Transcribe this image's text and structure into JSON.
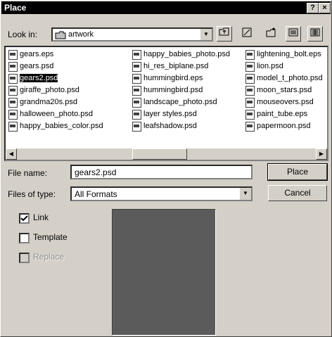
{
  "window": {
    "title": "Place",
    "help_label": "?",
    "close_label": "×"
  },
  "lookin": {
    "label": "Look in:",
    "value": "artwork",
    "icons": [
      "up-folder-icon",
      "desktop-icon",
      "new-folder-icon",
      "list-view-icon",
      "details-view-icon"
    ]
  },
  "files": {
    "col1": [
      "gears.eps",
      "gears.psd",
      "gears2.psd",
      "giraffe_photo.psd",
      "grandma20s.psd",
      "halloween_photo.psd",
      "happy_babies_color.psd"
    ],
    "col2": [
      "happy_babies_photo.psd",
      "hi_res_biplane.psd",
      "hummingbird.eps",
      "hummingbird.psd",
      "landscape_photo.psd",
      "layer styles.psd",
      "leafshadow.psd"
    ],
    "col3": [
      "lightening_bolt.eps",
      "lion.psd",
      "model_t_photo.psd",
      "moon_stars.psd",
      "mouseovers.psd",
      "paint_tube.eps",
      "papermoon.psd"
    ],
    "selected": "gears2.psd"
  },
  "filename": {
    "label": "File name:",
    "value": "gears2.psd"
  },
  "filetype": {
    "label": "Files of type:",
    "value": "All Formats"
  },
  "buttons": {
    "place": "Place",
    "cancel": "Cancel"
  },
  "options": {
    "link": {
      "label": "Link",
      "checked": true
    },
    "template": {
      "label": "Template",
      "checked": false
    },
    "replace": {
      "label": "Replace",
      "checked": false,
      "disabled": true
    }
  }
}
